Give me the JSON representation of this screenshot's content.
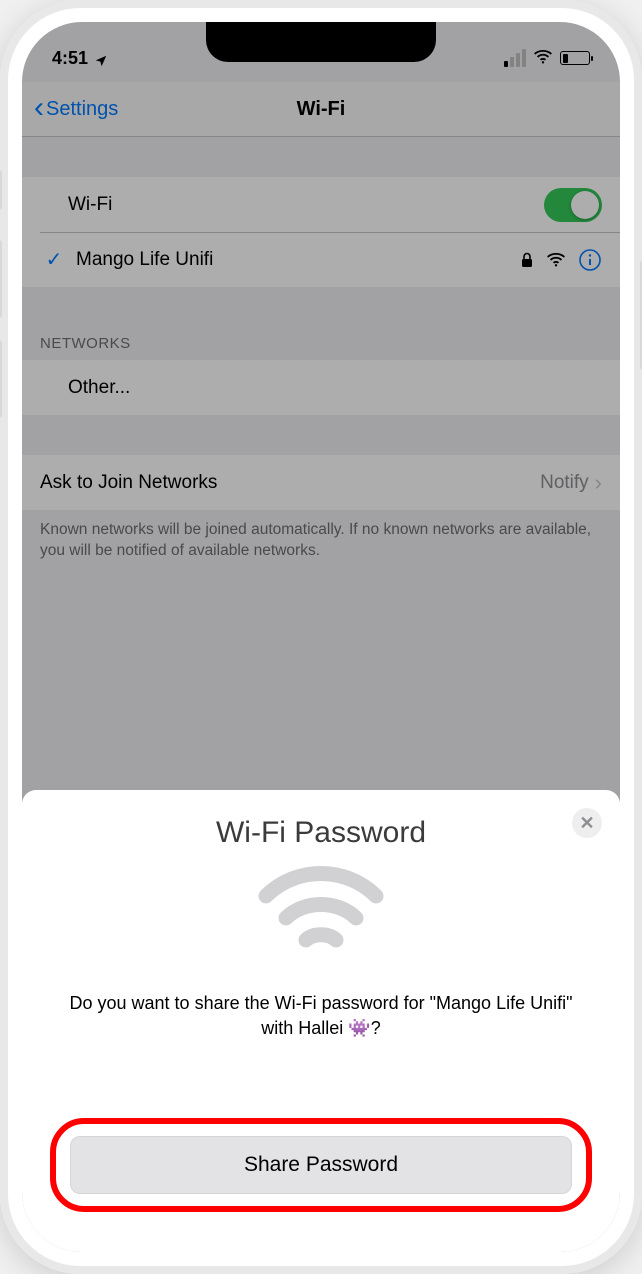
{
  "status": {
    "time": "4:51",
    "location_icon": "location",
    "wifi_connected": true,
    "battery_percent_unknown": true
  },
  "nav": {
    "back_label": "Settings",
    "title": "Wi-Fi"
  },
  "wifi": {
    "toggle_label": "Wi-Fi",
    "connected_network": "Mango Life Unifi"
  },
  "networks": {
    "header": "NETWORKS",
    "other_label": "Other..."
  },
  "ask": {
    "label": "Ask to Join Networks",
    "value": "Notify",
    "footer": "Known networks will be joined automatically. If no known networks are available, you will be notified of available networks."
  },
  "sheet": {
    "title": "Wi-Fi Password",
    "message": "Do you want to share the Wi-Fi password for \"Mango Life Unifi\" with Hallei 👾?",
    "share_label": "Share Password"
  }
}
